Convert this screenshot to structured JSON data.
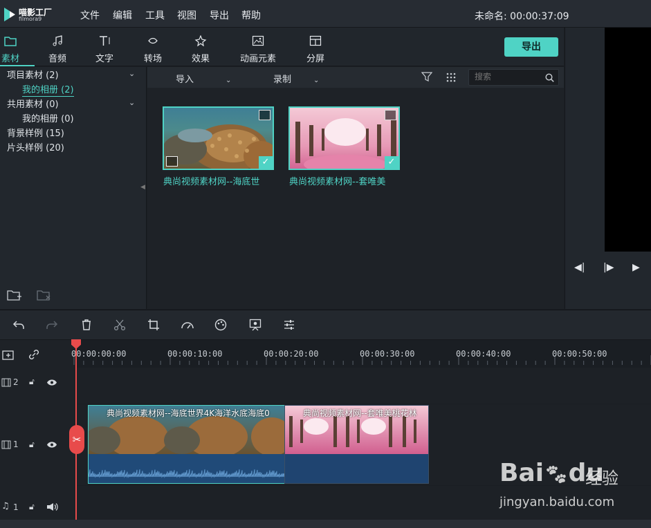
{
  "app": {
    "logo_name": "喵影工厂",
    "logo_sub": "filmora9",
    "project_title": "未命名: 00:00:37:09"
  },
  "menu": [
    "文件",
    "编辑",
    "工具",
    "视图",
    "导出",
    "帮助"
  ],
  "tabs": [
    {
      "label": "素材",
      "icon": "folder-icon",
      "active": true
    },
    {
      "label": "音频",
      "icon": "music-icon"
    },
    {
      "label": "文字",
      "icon": "text-icon"
    },
    {
      "label": "转场",
      "icon": "transition-icon"
    },
    {
      "label": "效果",
      "icon": "effects-icon"
    },
    {
      "label": "动画元素",
      "icon": "elements-icon"
    },
    {
      "label": "分屏",
      "icon": "split-screen-icon"
    }
  ],
  "export_label": "导出",
  "library": [
    {
      "label": "项目素材 (2)",
      "indent": 0,
      "expandable": true
    },
    {
      "label": "我的相册 (2)",
      "indent": 1,
      "selected": true
    },
    {
      "label": "共用素材 (0)",
      "indent": 0,
      "expandable": true
    },
    {
      "label": "我的相册 (0)",
      "indent": 1
    },
    {
      "label": "背景样例 (15)",
      "indent": 0
    },
    {
      "label": "片头样例 (20)",
      "indent": 0
    }
  ],
  "media_toolbar": {
    "import_label": "导入",
    "record_label": "录制",
    "search_placeholder": "搜索"
  },
  "media_items": [
    {
      "name": "典尚视频素材网--海底世",
      "theme": "underwater"
    },
    {
      "name": "典尚视频素材网--套唯美",
      "theme": "blossom"
    }
  ],
  "ruler_labels": [
    "00:00:00:00",
    "00:00:10:00",
    "00:00:20:00",
    "00:00:30:00",
    "00:00:40:00",
    "00:00:50:00"
  ],
  "tracks": [
    {
      "label": "2",
      "type": "video"
    },
    {
      "label": "1",
      "type": "video"
    },
    {
      "label": "1",
      "type": "audio"
    }
  ],
  "timeline_clips": [
    {
      "title": "典尚视频素材网--海底世界4K海洋水底海底0",
      "theme": "underwater"
    },
    {
      "title": "典尚视频素材网--套唯美桃花林",
      "theme": "blossom"
    }
  ],
  "watermark": {
    "brand": "Bai",
    "brand2": "du",
    "jingyan": "经验",
    "url": "jingyan.baidu.com"
  }
}
